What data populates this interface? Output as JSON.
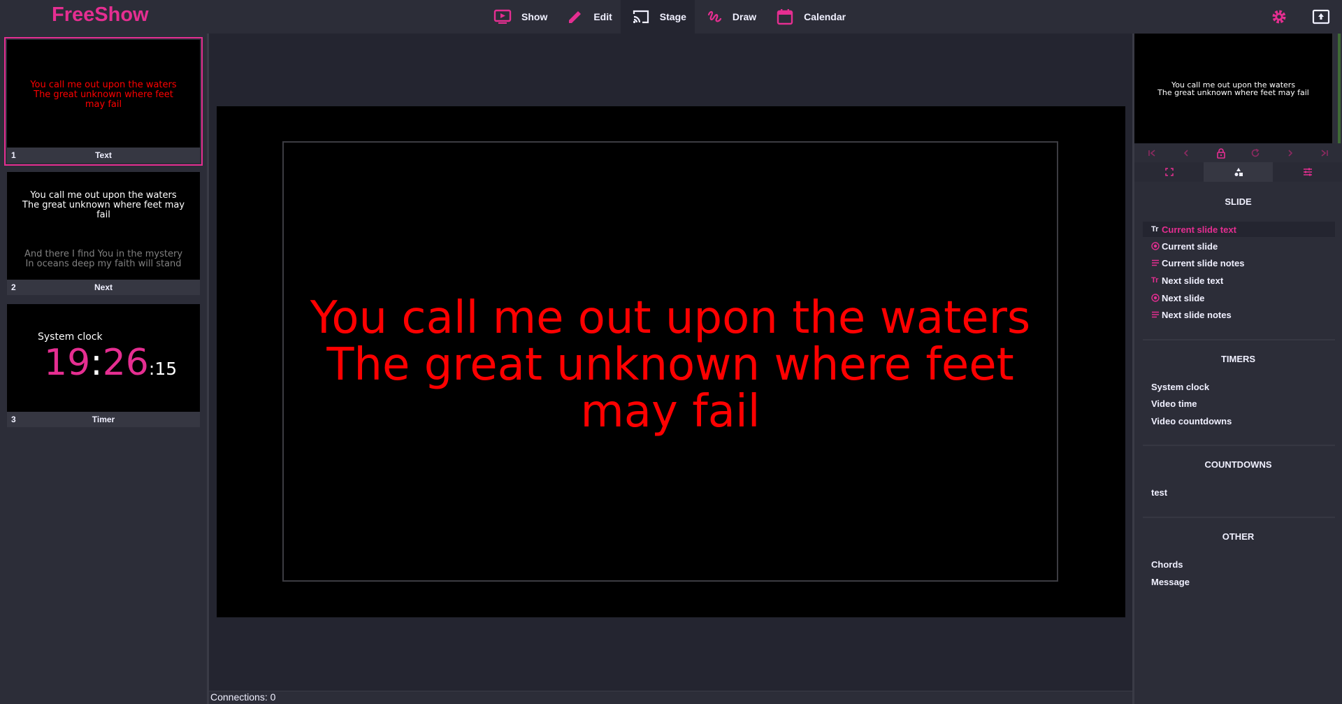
{
  "app": {
    "logo": "FreeShow"
  },
  "nav": [
    {
      "label": "Show",
      "icon": "play-screen-icon"
    },
    {
      "label": "Edit",
      "icon": "pencil-icon"
    },
    {
      "label": "Stage",
      "icon": "cast-icon",
      "active": true
    },
    {
      "label": "Draw",
      "icon": "draw-icon"
    },
    {
      "label": "Calendar",
      "icon": "calendar-icon"
    }
  ],
  "slides": [
    {
      "num": "1",
      "name": "Text",
      "lines": [
        "You call me out upon the waters",
        "The great unknown where feet",
        "may fail"
      ]
    },
    {
      "num": "2",
      "name": "Next",
      "lines": [
        "You call me out upon the waters",
        "The great unknown where feet may",
        "fail"
      ],
      "next_lines": [
        "And there I find You in the mystery",
        "In oceans deep my faith will stand"
      ]
    },
    {
      "num": "3",
      "name": "Timer",
      "clock_label": "System clock",
      "clock_h": "19",
      "clock_m": "26",
      "clock_s": "15"
    }
  ],
  "stage": {
    "lines": [
      "You call me out upon the waters",
      "The great unknown where feet",
      "may fail"
    ]
  },
  "status": {
    "connections": "Connections: 0"
  },
  "preview": {
    "lines": [
      "You call me out upon the waters",
      "The great unknown where feet may fail"
    ]
  },
  "sidebar": {
    "slide_title": "SLIDE",
    "slide_items": [
      "Current slide text",
      "Current slide",
      "Current slide notes",
      "Next slide text",
      "Next slide",
      "Next slide notes"
    ],
    "timers_title": "TIMERS",
    "timers_items": [
      "System clock",
      "Video time",
      "Video countdowns"
    ],
    "countdowns_title": "COUNTDOWNS",
    "countdowns_items": [
      "test"
    ],
    "other_title": "OTHER",
    "other_items": [
      "Chords",
      "Message"
    ]
  },
  "colors": {
    "accent": "#e52e91",
    "stage_text": "#ff0000",
    "background": "#242530",
    "panel": "#2c2d38"
  }
}
